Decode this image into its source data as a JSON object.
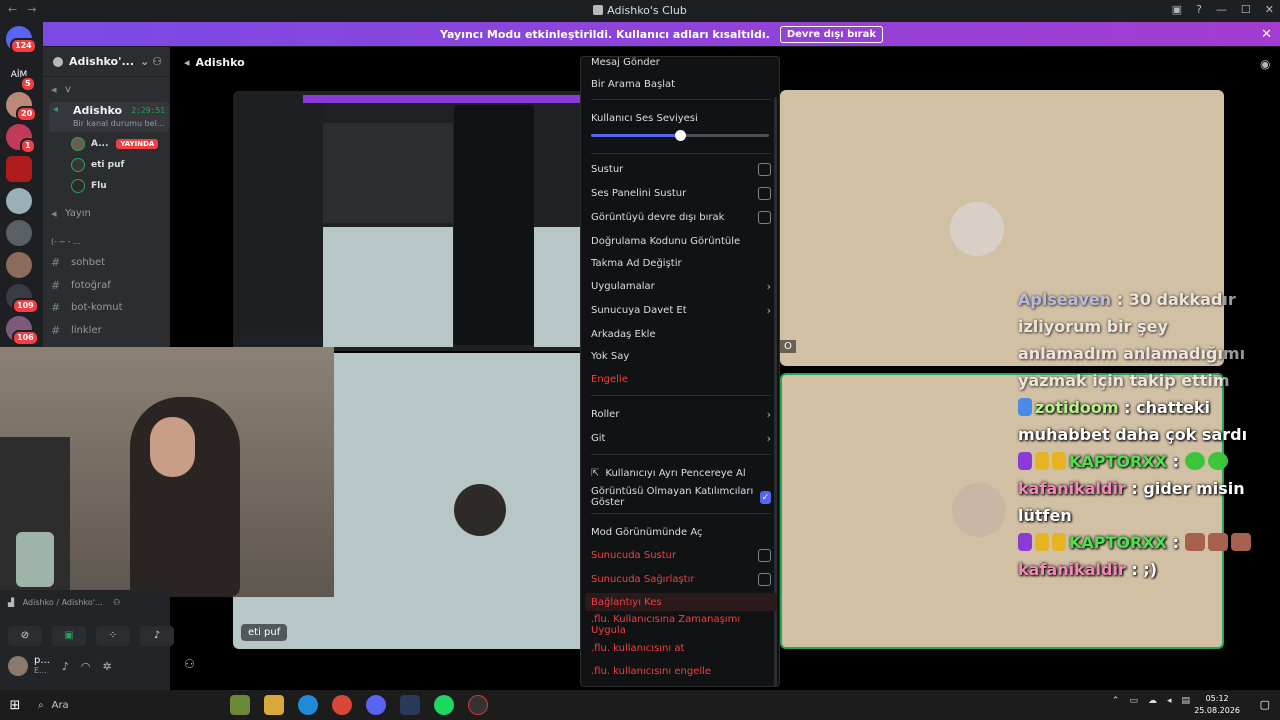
{
  "window": {
    "title": "Adishko's Club"
  },
  "banner": {
    "text": "Yayıncı Modu etkinleştirildi. Kullanıcı adları kısaltıldı.",
    "button": "Devre dışı bırak"
  },
  "rail": {
    "badges": [
      "124",
      "5",
      "20",
      "1",
      "109",
      "106"
    ],
    "aim_label": "AİM"
  },
  "sidebar": {
    "guild_name": "Adishko'...",
    "collapsed_category": "v",
    "voice_channel": "Adishko",
    "voice_time": "2:29:51",
    "voice_status": "Bir kanal durumu bel...",
    "members": [
      {
        "name": "A...",
        "live": "YAYINDA"
      },
      {
        "name": "eti puf"
      },
      {
        "name": "Flu"
      }
    ],
    "stream_channel": "Yayın",
    "category_divider": "(- - ̶ - ...",
    "text_channels": [
      "sohbet",
      "fotoğraf",
      "bot-komut",
      "linkler"
    ]
  },
  "userpanel": {
    "connection": "Adishko / Adishko'...",
    "user_short": "p...",
    "user_status": "E..."
  },
  "call": {
    "channel_title": "Adishko",
    "tile_label": "eti puf",
    "overlay_letter": "O"
  },
  "context_menu": {
    "items": [
      {
        "label": "Mesaj Gönder"
      },
      {
        "label": "Bir Arama Başlat"
      }
    ],
    "volume_label": "Kullanıcı Ses Seviyesi",
    "volume_level": 0.5,
    "toggles": [
      {
        "label": "Sustur",
        "checked": false
      },
      {
        "label": "Ses Panelini Sustur",
        "checked": false
      },
      {
        "label": "Görüntüyü devre dışı bırak",
        "checked": false
      }
    ],
    "actions": [
      {
        "label": "Doğrulama Kodunu Görüntüle"
      },
      {
        "label": "Takma Ad Değiştir"
      },
      {
        "label": "Uygulamalar",
        "submenu": true
      },
      {
        "label": "Sunucuya Davet Et",
        "submenu": true
      },
      {
        "label": "Arkadaş Ekle"
      },
      {
        "label": "Yok Say"
      },
      {
        "label": "Engelle",
        "danger": true
      }
    ],
    "roles": [
      {
        "label": "Roller",
        "submenu": true
      },
      {
        "label": "Git",
        "submenu": true
      }
    ],
    "popout": "Kullanıcıyı Ayrı Pencereye Al",
    "show_nonvideo": "Görüntüsü Olmayan Katılımcıları Göster",
    "show_nonvideo_checked": true,
    "mod_view": "Mod Görünümünde Aç",
    "server_mute": "Sunucuda Sustur",
    "server_deafen": "Sunucuda Sağırlaştır",
    "disconnect": "Bağlantıyı Kes",
    "timeout": ".flu. Kullanıcısına Zamanaşımı Uygula",
    "kick": ".flu. kullanıcısını at",
    "ban": ".flu. kullanıcısını engelle"
  },
  "chat": {
    "messages": [
      {
        "user": "Aplseaven",
        "text": ": 30 dakkadır izliyorum bir şey anlamadım anlamadığımı yazmak için takip ettim"
      },
      {
        "user": "zotidoom",
        "text": ": chatteki muhabbet daha çok sardı"
      },
      {
        "user": "KAPTORXX",
        "text": ":"
      },
      {
        "user": "kafanikaldir",
        "text": ": gider misin lütfen"
      },
      {
        "user": "KAPTORXX",
        "text": ":"
      },
      {
        "user": "kafanikaldir",
        "text": ": ;)"
      }
    ]
  },
  "taskbar": {
    "search": "Ara",
    "time": "05:12",
    "date": "25.08.2026"
  },
  "colors": {
    "accent": "#5865f2",
    "danger": "#f23f43",
    "online": "#23a55a",
    "banner": "#a33ccf"
  }
}
